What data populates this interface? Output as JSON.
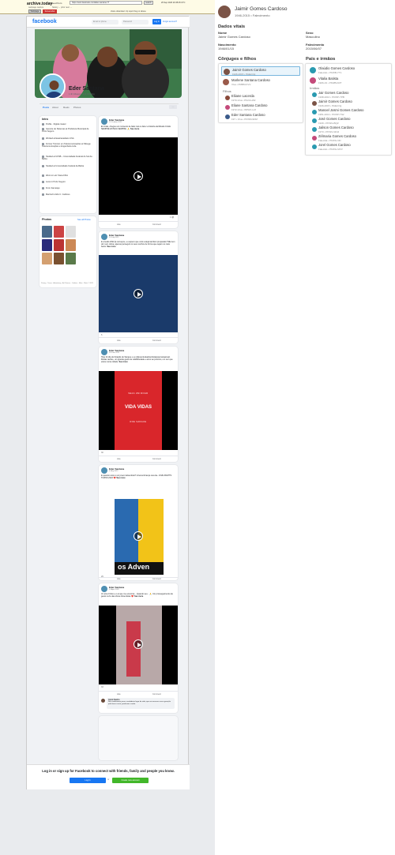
{
  "archive": {
    "logo": "archive.today",
    "sub": "webpage capture",
    "url_label": "Saved from",
    "url": "https://web.facebook.com/Eder.santana.77",
    "go": "search",
    "date": "29 Sep 2023 20:38:25 UTC",
    "mid": "history ← prior next →",
    "btn_webpage": "Webpage",
    "btn_screenshot": "Screenshot",
    "share": "share  download .zip  report bug or abuse"
  },
  "fb": {
    "logo": "facebook",
    "email_ph": "Email or phone",
    "pass_ph": "Password",
    "login": "Log In",
    "forgot": "Forgot account?",
    "profile_name": "Eder Santana",
    "friends": "1.4K followers · 122 following",
    "tabs": [
      "Posts",
      "About",
      "Reels",
      "Photos"
    ],
    "more": "···",
    "intro_title": "Intro",
    "intro": [
      "Profile · Digital creator",
      "Gerente de Sistemas at Prefeitura Municipal de Porto Seguro",
      "Worked at Eastcanadians USA",
      "Former Técnico em Telecomunicações at Nilsege Telecomunicações e Engenharia Ltda",
      "Studied at UFSB – Universidade Federal do Sul da Bahia",
      "Studied at Universidade Federal da Bahia",
      "Went to Luiz Viana Filho",
      "Lives in Porto Seguro",
      "From Itamaraju",
      "Married to Elis C. Cardoso"
    ],
    "photos_title": "Photos",
    "photos_link": "See all Photos",
    "footer_links": "Privacy · Terms · Advertising · Ad Choices · Cookies · More · Meta © 2023",
    "posts": [
      {
        "name": "Eder Santana",
        "date": "10 October 2022",
        "text": "Ei irmão, chegou um momento de falar mal ou fazer a história da Missão Cristã. SEMPRE ESTEJA SEMPRE. 🙏",
        "see_more": "See more",
        "like": "Like",
        "comment": "Comment",
        "count": "1 👁"
      },
      {
        "name": "Eder Santana",
        "date": "10 July 2022",
        "text": "E a lesão 2022 já começou, eu espero que você esteja também preparado! Não tem dor nem rotina, apenas perseguir os seus sonhos de forma que sejam os mais belos.",
        "see_more": "See more",
        "like": "Like",
        "comment": "Comment",
        "count": "6"
      },
      {
        "name": "Eder Santana",
        "date": "18 June 2022",
        "text": "Hoje foi dia de Doação de Sangue e eu @juventudeadventistaassemanaanual. Muitas razões, um grande gesto de solidariedade e amor ao próximo, um vez que estou numa cidade.",
        "see_more": "See more",
        "like": "Like",
        "comment": "Comment",
        "count": "30"
      },
      {
        "name": "Eder Santana",
        "date": "4 May 2022",
        "text": "E quando você é um jovem Adventista? Uma lembrança recente. JUVE RIGHTS TURNS 2022 ❤️",
        "see_more": "See more",
        "like": "Like",
        "comment": "Comment",
        "count": "29"
      },
      {
        "name": "Eder Santana",
        "date": "14 April 2022",
        "text": "Vc ama Cristo e é aí que me encontra... Quando seu... 🙏 Um prosseguimento de gesto na fé das obras Adventistas ❤️",
        "see_more": "See more",
        "like": "Like",
        "comment": "Comment",
        "count": "33"
      }
    ],
    "comment_author": "Aroni Castro",
    "comment_text": "Nós mudaremos para o verdadeiro lugar de vida, que vai encerrar nessa geração pela busca certa, paralisam a onda.",
    "login_msg": "Log in or sign up for Facebook to connect with friends, family and people you know.",
    "login_btn": "Log In",
    "or": "or",
    "create_btn": "Create new account",
    "video_text": "SEJA UM DOAD",
    "video_text2": "VIDA VIDAS",
    "video_text3": "DOE SANGUE",
    "video_text4": "os Adven"
  },
  "person": {
    "name": "Jaimir Gomes Cardoso",
    "sub": "1946-2015 • Falecimento",
    "vital_title": "Dados vitais",
    "nome_lbl": "Nome",
    "nome_val": "Jaimir Gomes Cardoso",
    "sexo_lbl": "Sexo",
    "sexo_val": "Masculino",
    "nasc_lbl": "Nascimento",
    "nasc_val": "1946/01/15",
    "fal_lbl": "Falecimento",
    "fal_val": "2015/06/07",
    "spouses_title": "Cônjuges e filhos",
    "parents_title": "Pais e irmãos",
    "filhos_lbl": "Filhos",
    "irmaos_lbl": "Irmãos",
    "spouse_self": {
      "name": "Jaimir Gomes Cardoso",
      "dates": "1946-2015 • PAE2-Ng"
    },
    "spouse": {
      "name": "Marlene Santana Cardoso",
      "dates": "Viva • PMBM-KVV"
    },
    "children": [
      {
        "name": "Eliiane Lacerda",
        "dates": "1970-Viva • PK23-LW2"
      },
      {
        "name": "Eliane Santana Cardoso",
        "dates": "1972-Viva • WPHX-L2J"
      },
      {
        "name": "Eder Santana Cardoso",
        "dates": "197 • Viva • PKWM-9DM"
      }
    ],
    "parents": [
      {
        "name": "Olaúdio Gomes Cardoso",
        "dates": "Falecido • PKWB-YT1"
      },
      {
        "name": "Vitalia Batista",
        "dates": "1906-19 • PKWB-KRT"
      }
    ],
    "siblings": [
      {
        "name": "Jair Gomes Cardoso",
        "dates": "1938-2010 • PKWP-YPB"
      },
      {
        "name": "Jaimir Gomes Cardoso",
        "dates": "1946-2015 • PAE2-Ng"
      },
      {
        "name": "Manoel Josmi Gomes Cardoso",
        "dates": "1951-2013 • PKWP-TN2"
      },
      {
        "name": "José Gomes Cardoso",
        "dates": "1949 • PKWG-BQZ"
      },
      {
        "name": "Jailson Gomes Cardoso",
        "dates": "1973 • PKWG-WH2"
      },
      {
        "name": "Zélmaria Gomes Cardoso",
        "dates": "Falecida • PKWG-ND"
      },
      {
        "name": "Jorel Gomes Cardoso",
        "dates": "Falecido • PKWG-MVV"
      }
    ]
  },
  "colors": {
    "fb_blue": "#1877f2",
    "fb_green": "#42b72a",
    "selected_bg": "#e9f4fb"
  }
}
